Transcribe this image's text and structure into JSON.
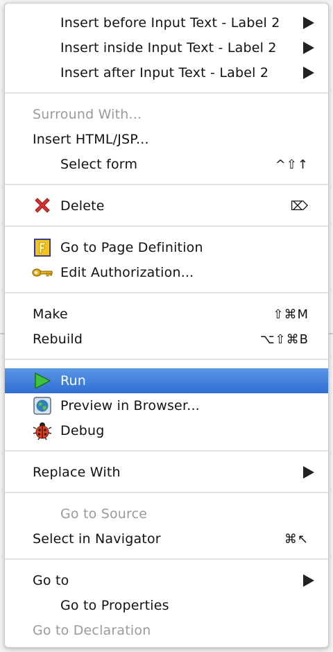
{
  "menu": {
    "insert_before": "Insert before Input Text - Label 2",
    "insert_inside": "Insert inside Input Text - Label 2",
    "insert_after": "Insert after Input Text - Label 2",
    "surround_with": "Surround With...",
    "insert_html_jsp": "Insert HTML/JSP...",
    "select_form": "Select form",
    "select_form_shortcut": "^⇧↑",
    "delete": "Delete",
    "delete_shortcut": "⌦",
    "go_to_page_definition": "Go to Page Definition",
    "edit_authorization": "Edit Authorization...",
    "make": "Make",
    "make_shortcut": "⇧⌘M",
    "rebuild": "Rebuild",
    "rebuild_shortcut": "⌥⇧⌘B",
    "run": "Run",
    "preview_in_browser": "Preview in Browser...",
    "debug": "Debug",
    "replace_with": "Replace With",
    "go_to_source": "Go to Source",
    "select_in_navigator": "Select in Navigator",
    "select_in_navigator_shortcut": "⌘↖",
    "go_to": "Go to",
    "go_to_properties": "Go to Properties",
    "go_to_declaration": "Go to Declaration"
  },
  "icons": {
    "delete": "red-x-icon",
    "page_definition": "page-definition-icon",
    "authorization": "key-icon",
    "run": "green-play-icon",
    "preview": "globe-icon",
    "debug": "ladybug-icon"
  },
  "colors": {
    "selection": "#3e7fdb",
    "disabled_text": "#9a9a9a"
  }
}
